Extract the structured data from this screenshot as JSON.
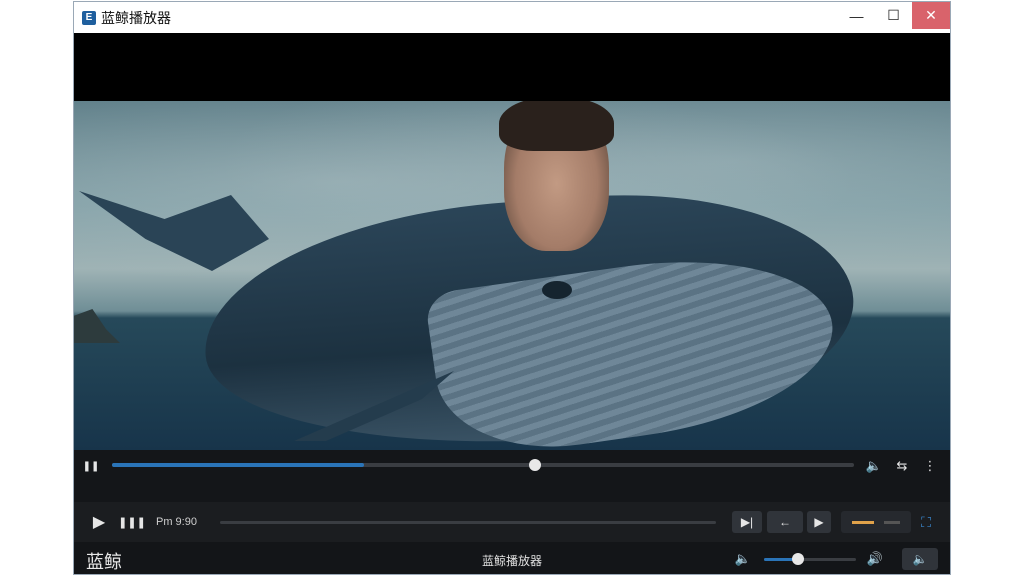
{
  "window": {
    "title": "蓝鲸播放器",
    "app_icon_glyph": "E",
    "controls": {
      "minimize_glyph": "—",
      "maximize_glyph": "☐",
      "close_glyph": "✕",
      "close_color": "#d9636b"
    }
  },
  "video": {
    "progress_fraction": 0.57,
    "buffer_fraction": 0.34
  },
  "controls": {
    "row1": {
      "pause_glyph": "❚❚",
      "volume_glyph": "🔈",
      "loop_glyph": "⇆",
      "more_glyph": "⋮"
    },
    "row2": {
      "play_glyph": "▶",
      "bars_glyph": "❚❚❚",
      "time_text": "Pm 9:90",
      "speed_fraction": 0.14,
      "next_glyph": "▶|",
      "rewind_glyph": "←",
      "forward_glyph": "▶",
      "fullscreen_glyph": "⛶"
    },
    "row3": {
      "brand_text": "蓝鲸",
      "title_text": "蓝鲸播放器",
      "volume_fraction": 0.37,
      "volume_left_glyph": "🔈",
      "volume_right_glyph": "🔊",
      "mute_glyph": "🔈"
    }
  },
  "colors": {
    "accent": "#2a74b8",
    "control_bg": "#141619"
  }
}
